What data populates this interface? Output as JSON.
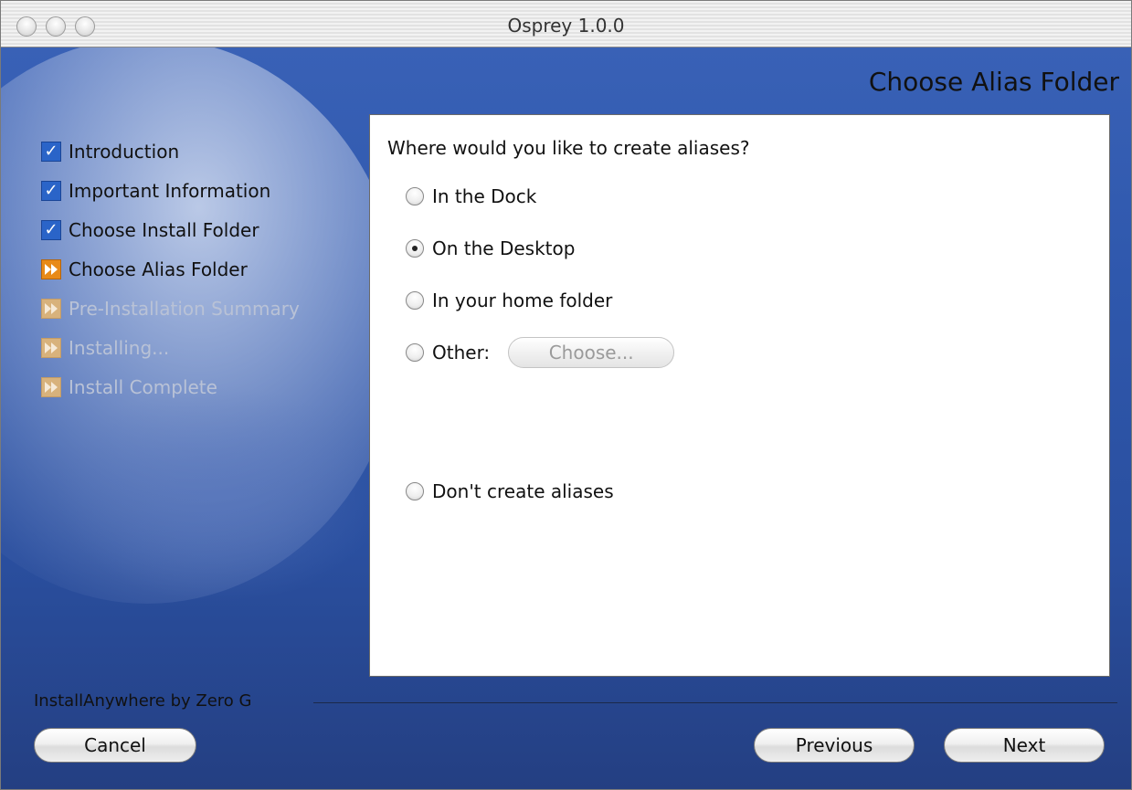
{
  "window": {
    "title": "Osprey 1.0.0"
  },
  "page": {
    "heading": "Choose Alias Folder"
  },
  "steps": [
    {
      "label": "Introduction",
      "state": "done",
      "icon": "checkmark-icon"
    },
    {
      "label": "Important Information",
      "state": "done",
      "icon": "checkmark-icon"
    },
    {
      "label": "Choose Install Folder",
      "state": "done",
      "icon": "checkmark-icon"
    },
    {
      "label": "Choose Alias Folder",
      "state": "current",
      "icon": "fast-forward-icon"
    },
    {
      "label": "Pre-Installation Summary",
      "state": "pending",
      "icon": "fast-forward-icon"
    },
    {
      "label": "Installing...",
      "state": "pending",
      "icon": "fast-forward-icon"
    },
    {
      "label": "Install Complete",
      "state": "pending",
      "icon": "fast-forward-icon"
    }
  ],
  "form": {
    "question": "Where would you like to create aliases?",
    "options": [
      {
        "label": "In the Dock",
        "checked": false
      },
      {
        "label": "On the Desktop",
        "checked": true
      },
      {
        "label": "In your home folder",
        "checked": false
      },
      {
        "label": "Other:",
        "checked": false
      },
      {
        "label": "Don't create aliases",
        "checked": false
      }
    ],
    "choose_label": "Choose..."
  },
  "footer": {
    "vendor": "InstallAnywhere by Zero G",
    "cancel_label": "Cancel",
    "previous_label": "Previous",
    "next_label": "Next"
  },
  "colors": {
    "background": "#2f58ad",
    "step_done": "#2a64c8",
    "step_arrow": "#e88a18"
  }
}
